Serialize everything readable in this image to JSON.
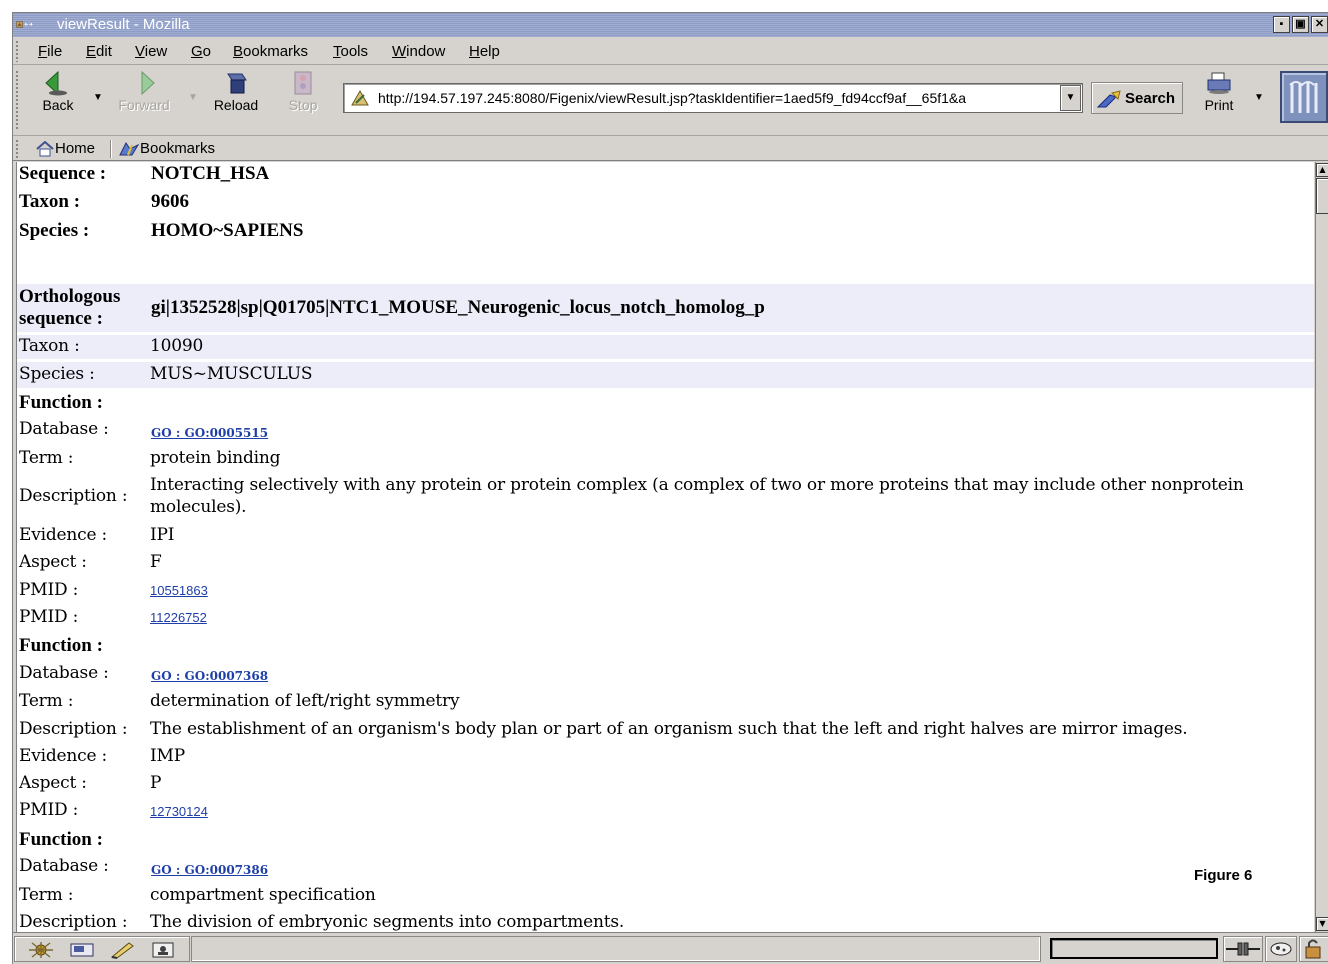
{
  "window": {
    "title": "viewResult - Mozilla",
    "buttons": {
      "minimize": "▪",
      "maximize": "▣",
      "close": "✕"
    }
  },
  "menu": {
    "items": [
      {
        "label": "File"
      },
      {
        "label": "Edit"
      },
      {
        "label": "View"
      },
      {
        "label": "Go"
      },
      {
        "label": "Bookmarks"
      },
      {
        "label": "Tools"
      },
      {
        "label": "Window"
      },
      {
        "label": "Help"
      }
    ]
  },
  "nav": {
    "back_label": "Back",
    "forward_label": "Forward",
    "reload_label": "Reload",
    "stop_label": "Stop",
    "url": "http://194.57.197.245:8080/Figenix/viewResult.jsp?taskIdentifier=1aed5f9_fd94ccf9af__65f1&a",
    "search_label": "Search",
    "print_label": "Print",
    "dropdown_glyph": "▼"
  },
  "personal_toolbar": {
    "home_label": "Home",
    "bookmarks_label": "Bookmarks"
  },
  "content": {
    "query": {
      "sequence_label": "Sequence :",
      "sequence_value": "NOTCH_HSA",
      "taxon_label": "Taxon :",
      "taxon_value": "9606",
      "species_label": "Species :",
      "species_value": "HOMO~SAPIENS"
    },
    "ortholog": {
      "label_line1": "Orthologous",
      "label_line2": "sequence :",
      "value": "gi|1352528|sp|Q01705|NTC1_MOUSE_Neurogenic_locus_notch_homolog_p",
      "taxon_label": "Taxon :",
      "taxon_value": "10090",
      "species_label": "Species :",
      "species_value": "MUS~MUSCULUS"
    },
    "functions": [
      {
        "heading": "Function :",
        "database_label": "Database :",
        "database_value": "GO : GO:0005515",
        "term_label": "Term :",
        "term_value": "protein binding",
        "description_label": "Description :",
        "description_line1": "Interacting selectively with any protein or protein complex (a complex of two or more proteins that may include other nonprotein",
        "description_line2": "molecules).",
        "evidence_label": "Evidence :",
        "evidence_value": "IPI",
        "aspect_label": "Aspect :",
        "aspect_value": "F",
        "pmids": [
          {
            "label": "PMID :",
            "value": "10551863"
          },
          {
            "label": "PMID :",
            "value": "11226752"
          }
        ]
      },
      {
        "heading": "Function :",
        "database_label": "Database :",
        "database_value": "GO : GO:0007368",
        "term_label": "Term :",
        "term_value": "determination of left/right symmetry",
        "description_label": "Description :",
        "description_line1": "The establishment of an organism's body plan or part of an organism such that the left and right halves are mirror images.",
        "evidence_label": "Evidence :",
        "evidence_value": "IMP",
        "aspect_label": "Aspect :",
        "aspect_value": "P",
        "pmids": [
          {
            "label": "PMID :",
            "value": "12730124"
          }
        ]
      },
      {
        "heading": "Function :",
        "database_label": "Database :",
        "database_value": "GO : GO:0007386",
        "term_label": "Term :",
        "term_value": "compartment specification",
        "description_label": "Description :",
        "description_line1": "The division of embryonic segments into compartments."
      }
    ],
    "figure_caption": "Figure 6"
  },
  "scrollbar": {
    "up": "▲",
    "down": "▼"
  },
  "colors": {
    "titlebar": "#8c9cc7",
    "chrome": "#d6d3ce",
    "row_shade": "#ededfa",
    "link": "#1f3fa8"
  }
}
